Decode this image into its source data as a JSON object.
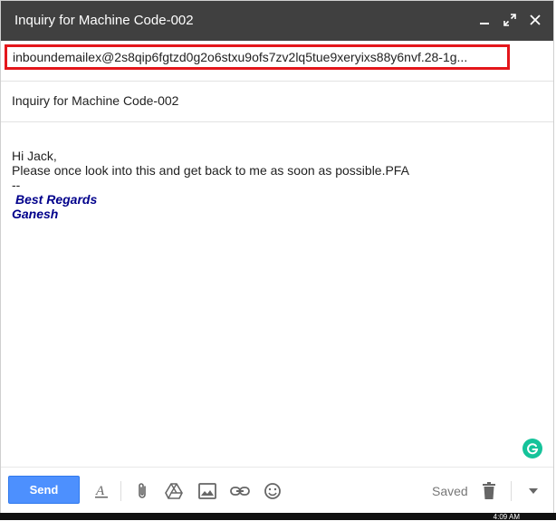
{
  "window": {
    "title": "Inquiry for Machine Code-002"
  },
  "compose": {
    "recipients": "inboundemailex@2s8qip6fgtzd0g2o6stxu9ofs7zv2lq5tue9xeryixs88y6nvf.28-1g...",
    "subject": "Inquiry for Machine Code-002",
    "body": {
      "greeting": "Hi Jack,",
      "message": "Please once look into this and get back to me as soon as possible.PFA",
      "separator": "--",
      "signature_line1": "Best Regards",
      "signature_line2": "Ganesh"
    }
  },
  "toolbar": {
    "send_label": "Send",
    "saved_label": "Saved"
  },
  "taskbar": {
    "clock": "4:09 AM"
  },
  "colors": {
    "titlebar": "#404040",
    "send": "#4d90fe",
    "highlight": "#e4161b",
    "signature": "#00008b",
    "grammarly": "#15c39a"
  }
}
